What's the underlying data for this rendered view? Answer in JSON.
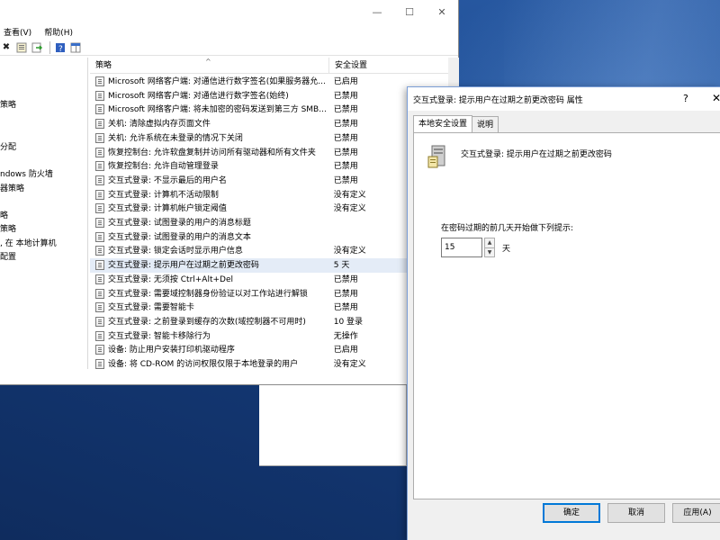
{
  "main_window": {
    "menu": [
      "查看(V)",
      "帮助(H)"
    ],
    "tree_items": [
      "策略",
      "分配",
      "ndows 防火墙",
      "器策略",
      "略",
      "策略",
      ", 在 本地计算机",
      "配置"
    ],
    "columns": {
      "policy": "策略",
      "setting": "安全设置"
    },
    "rows": [
      {
        "policy": "Microsoft 网络客户端: 对通信进行数字签名(如果服务器允...",
        "setting": "已启用"
      },
      {
        "policy": "Microsoft 网络客户端: 对通信进行数字签名(始终)",
        "setting": "已禁用"
      },
      {
        "policy": "Microsoft 网络客户端: 将未加密的密码发送到第三方 SMB...",
        "setting": "已禁用"
      },
      {
        "policy": "关机: 清除虚拟内存页面文件",
        "setting": "已禁用"
      },
      {
        "policy": "关机: 允许系统在未登录的情况下关闭",
        "setting": "已禁用"
      },
      {
        "policy": "恢复控制台: 允许软盘复制并访问所有驱动器和所有文件夹",
        "setting": "已禁用"
      },
      {
        "policy": "恢复控制台: 允许自动管理登录",
        "setting": "已禁用"
      },
      {
        "policy": "交互式登录: 不显示最后的用户名",
        "setting": "已禁用"
      },
      {
        "policy": "交互式登录: 计算机不活动限制",
        "setting": "没有定义"
      },
      {
        "policy": "交互式登录: 计算机帐户锁定阈值",
        "setting": "没有定义"
      },
      {
        "policy": "交互式登录: 试图登录的用户的消息标题",
        "setting": ""
      },
      {
        "policy": "交互式登录: 试图登录的用户的消息文本",
        "setting": ""
      },
      {
        "policy": "交互式登录: 锁定会话时显示用户信息",
        "setting": "没有定义"
      },
      {
        "policy": "交互式登录: 提示用户在过期之前更改密码",
        "setting": "5 天"
      },
      {
        "policy": "交互式登录: 无须按 Ctrl+Alt+Del",
        "setting": "已禁用"
      },
      {
        "policy": "交互式登录: 需要域控制器身份验证以对工作站进行解锁",
        "setting": "已禁用"
      },
      {
        "policy": "交互式登录: 需要智能卡",
        "setting": "已禁用"
      },
      {
        "policy": "交互式登录: 之前登录到缓存的次数(域控制器不可用时)",
        "setting": "10 登录"
      },
      {
        "policy": "交互式登录: 智能卡移除行为",
        "setting": "无操作"
      },
      {
        "policy": "设备: 防止用户安装打印机驱动程序",
        "setting": "已启用"
      },
      {
        "policy": "设备: 将 CD-ROM 的访问权限仅限于本地登录的用户",
        "setting": "没有定义"
      }
    ],
    "selected_index": 13
  },
  "dialog": {
    "title": "交互式登录: 提示用户在过期之前更改密码 属性",
    "help": "?",
    "close": "✕",
    "tabs": [
      "本地安全设置",
      "说明"
    ],
    "policy_title": "交互式登录: 提示用户在过期之前更改密码",
    "prompt_label": "在密码过期的前几天开始做下列提示:",
    "days_value": "15",
    "days_unit": "天",
    "ok_label": "确定",
    "cancel_label": "取消",
    "apply_label": "应用(A)"
  }
}
